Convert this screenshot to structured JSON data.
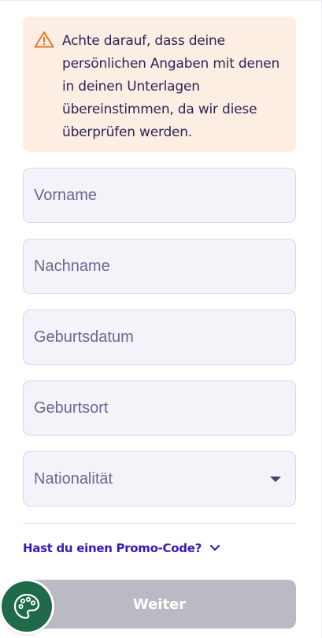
{
  "warning": {
    "icon": "warning-triangle-icon",
    "text": "Achte darauf, dass deine persönlichen Angaben mit denen in deinen Unterlagen übereinstimmen, da wir diese überprüfen werden."
  },
  "form": {
    "first_name_placeholder": "Vorname",
    "last_name_placeholder": "Nachname",
    "birth_date_placeholder": "Geburtsdatum",
    "birth_place_placeholder": "Geburtsort",
    "nationality_label": "Nationalität"
  },
  "promo": {
    "label": "Hast du einen Promo-Code?",
    "icon": "chevron-down-icon"
  },
  "submit": {
    "label": "Weiter"
  },
  "cookie_button": {
    "icon": "palette-icon"
  },
  "colors": {
    "warning_bg": "#fdeee3",
    "warning_icon": "#e07b2a",
    "field_bg": "#f4f3fa",
    "field_border": "#d9d5ee",
    "link": "#3a1ab7",
    "button_disabled": "#b9bac3",
    "cookie_bg": "#1f6a4a"
  }
}
